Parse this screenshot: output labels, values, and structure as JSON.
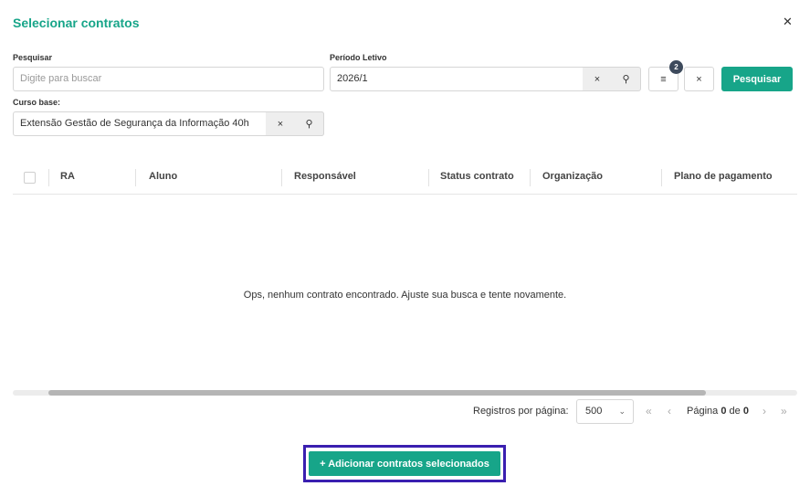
{
  "dialog": {
    "title": "Selecionar contratos",
    "close_icon": "close-icon"
  },
  "filters": {
    "search": {
      "label": "Pesquisar",
      "placeholder": "Digite para buscar",
      "value": ""
    },
    "period": {
      "label": "Período Letivo",
      "value": "2026/1"
    },
    "course": {
      "label": "Curso base:",
      "value": "Extensão Gestão de Segurança da Informação  40h"
    },
    "clear_glyph": "×",
    "search_glyph": "⚲",
    "filter_glyph": "≡",
    "filter_badge": "2",
    "search_button": "Pesquisar"
  },
  "table": {
    "columns": [
      "RA",
      "Aluno",
      "Responsável",
      "Status contrato",
      "Organização",
      "Plano de pagamento"
    ],
    "rows": [],
    "empty_message": "Ops, nenhum contrato encontrado. Ajuste sua busca e tente novamente."
  },
  "pagination": {
    "rows_label": "Registros por página:",
    "rows_value": "500",
    "page_label": "Página",
    "page_of": "de",
    "page_current": "0",
    "page_total": "0",
    "first": "«",
    "prev": "‹",
    "next": "›",
    "last": "»"
  },
  "footer": {
    "add_button": "+  Adicionar contratos selecionados"
  },
  "colors": {
    "accent": "#17a589",
    "badge": "#3d4a5c",
    "highlight": "#3a1fb0"
  }
}
